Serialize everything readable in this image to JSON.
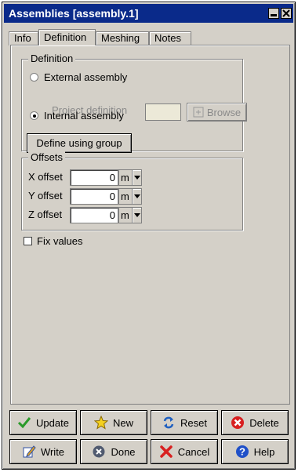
{
  "window": {
    "title": "Assemblies [assembly.1]"
  },
  "tabs": [
    "Info",
    "Definition",
    "Meshing",
    "Notes"
  ],
  "definition": {
    "group_title": "Definition",
    "external_label": "External assembly",
    "project_definition_label": "Project definition",
    "project_definition_value": "",
    "browse_label": "Browse",
    "internal_label": "Internal assembly",
    "selected": "Internal assembly",
    "define_group_label": "Define using group"
  },
  "offsets": {
    "group_title": "Offsets",
    "rows": [
      {
        "label": "X offset",
        "value": "0",
        "unit": "m"
      },
      {
        "label": "Y offset",
        "value": "0",
        "unit": "m"
      },
      {
        "label": "Z offset",
        "value": "0",
        "unit": "m"
      }
    ]
  },
  "fix_values": {
    "label": "Fix values",
    "checked": false
  },
  "actions": [
    {
      "label": "Update",
      "icon": "checkmark-icon"
    },
    {
      "label": "New",
      "icon": "star-icon"
    },
    {
      "label": "Reset",
      "icon": "reset-arrows-icon"
    },
    {
      "label": "Delete",
      "icon": "delete-x-icon"
    },
    {
      "label": "Write",
      "icon": "write-pencil-icon"
    },
    {
      "label": "Done",
      "icon": "done-circle-x-icon"
    },
    {
      "label": "Cancel",
      "icon": "cancel-x-icon"
    },
    {
      "label": "Help",
      "icon": "help-icon"
    }
  ],
  "colors": {
    "titlebar": "#0a2a8a",
    "face": "#d4d0c8",
    "check_green": "#2a9a2a",
    "delete_red": "#d82020",
    "help_blue": "#2050c8"
  }
}
